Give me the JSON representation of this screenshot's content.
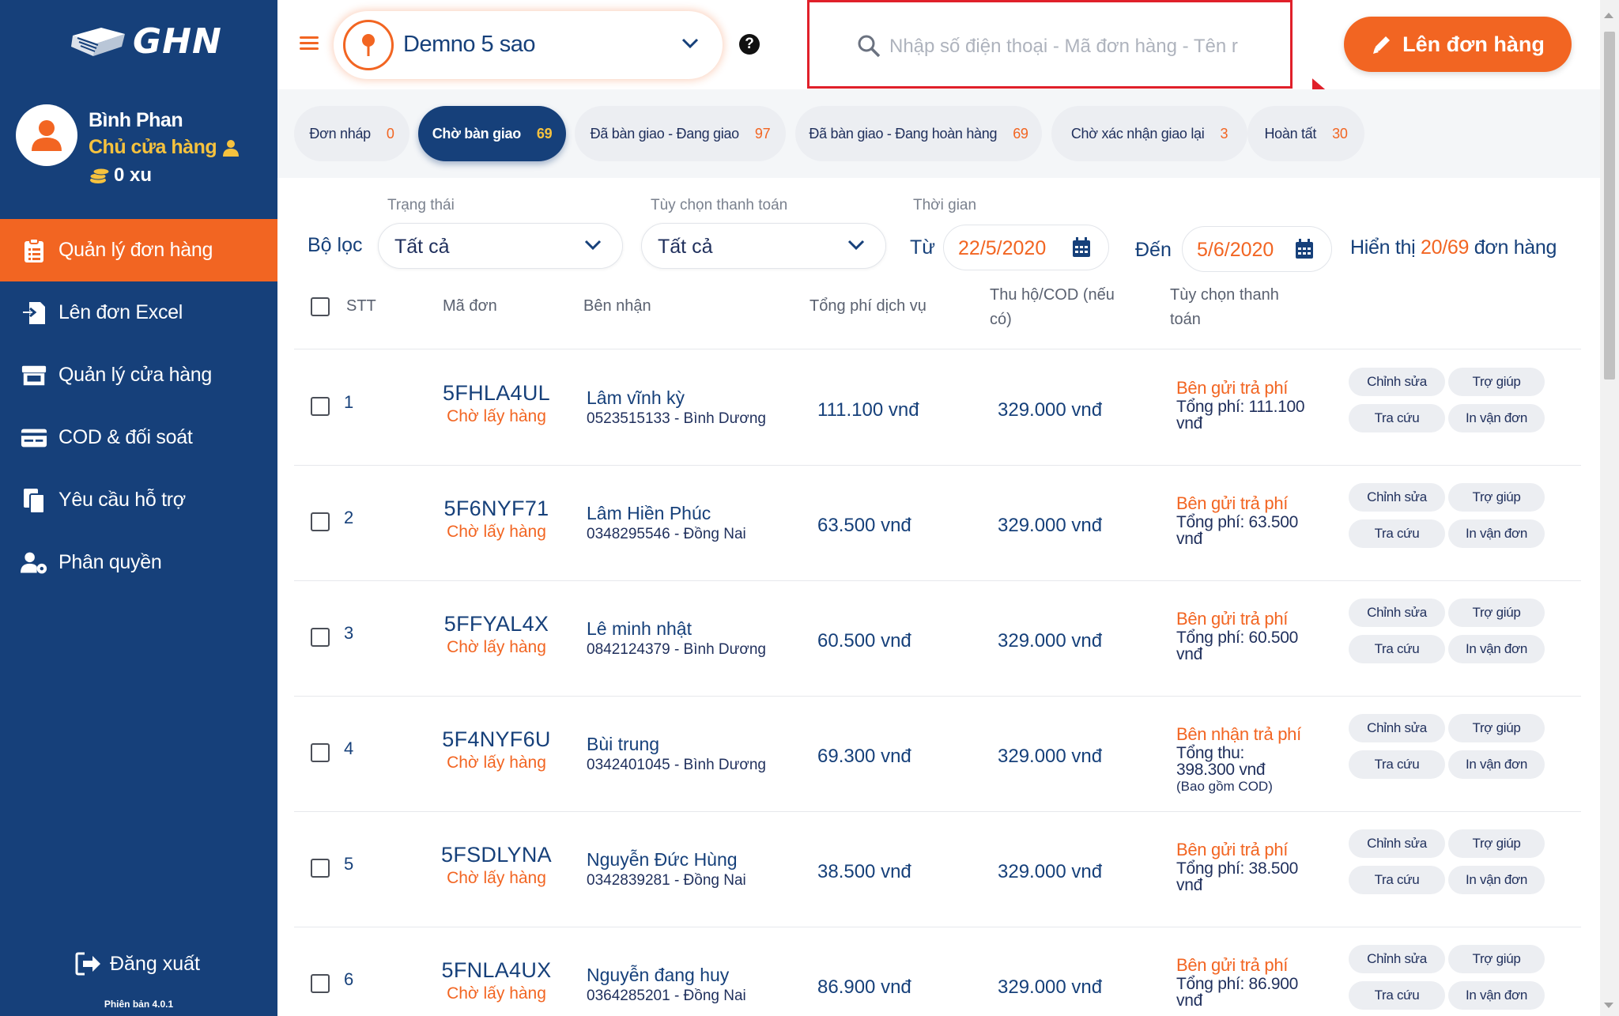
{
  "brand": {
    "logo_text": "GHN"
  },
  "user": {
    "name": "Bình Phan",
    "role": "Chủ cửa hàng",
    "coins": "0 xu"
  },
  "sidebar": {
    "items": [
      {
        "label": "Quản lý đơn hàng",
        "icon": "clipboard-icon",
        "active": true
      },
      {
        "label": "Lên đơn Excel",
        "icon": "file-import-icon",
        "active": false
      },
      {
        "label": "Quản lý cửa hàng",
        "icon": "store-icon",
        "active": false
      },
      {
        "label": "COD & đối soát",
        "icon": "card-icon",
        "active": false
      },
      {
        "label": "Yêu cầu hỗ trợ",
        "icon": "copy-icon",
        "active": false
      },
      {
        "label": "Phân quyền",
        "icon": "user-gear-icon",
        "active": false
      }
    ],
    "logout": "Đăng xuất",
    "version": "Phiên bản 4.0.1"
  },
  "header": {
    "store": "Demno 5 sao",
    "search_placeholder": "Nhập số điện thoại - Mã đơn hàng - Tên r",
    "create_button": "Lên đơn hàng"
  },
  "tabs": [
    {
      "label": "Đơn nháp",
      "count": "0"
    },
    {
      "label": "Chờ bàn giao",
      "count": "69"
    },
    {
      "label": "Đã bàn giao - Đang giao",
      "count": "97"
    },
    {
      "label": "Đã bàn giao - Đang hoàn hàng",
      "count": "69"
    },
    {
      "label": "Chờ xác nhận giao lại",
      "count": "3"
    },
    {
      "label": "Hoàn tất",
      "count": "30"
    }
  ],
  "filters": {
    "title": "Bộ lọc",
    "status_label": "Trạng thái",
    "status_value": "Tất cả",
    "payment_label": "Tùy chọn thanh toán",
    "payment_value": "Tất cả",
    "time_label": "Thời gian",
    "from_label": "Từ",
    "from_value": "22/5/2020",
    "to_label": "Đến",
    "to_value": "5/6/2020",
    "showing_prefix": "Hiển thị",
    "showing_count": "20/69",
    "showing_suffix": "đơn hàng"
  },
  "table": {
    "headers": {
      "stt": "STT",
      "code": "Mã đơn",
      "receiver": "Bên nhận",
      "fee": "Tổng phí dịch vụ",
      "cod_line1": "Thu hộ/COD (nếu",
      "cod_line2": "có)",
      "pay_line1": "Tùy chọn thanh",
      "pay_line2": "toán"
    },
    "actions": {
      "edit": "Chỉnh sửa",
      "help": "Trợ giúp",
      "lookup": "Tra cứu",
      "print": "In vận đơn"
    },
    "rows": [
      {
        "stt": "1",
        "code": "5FHLA4UL",
        "status": "Chờ lấy hàng",
        "name": "Lâm vĩnh kỳ",
        "contact": "0523515133 - Bình Dương",
        "fee": "111.100 vnđ",
        "cod": "329.000 vnđ",
        "pay_title": "Bên gửi trả phí",
        "pay_line1": "Tổng phí: 111.100",
        "pay_line2": "vnđ",
        "pay_note": ""
      },
      {
        "stt": "2",
        "code": "5F6NYF71",
        "status": "Chờ lấy hàng",
        "name": "Lâm Hiền Phúc",
        "contact": "0348295546 - Đồng Nai",
        "fee": "63.500 vnđ",
        "cod": "329.000 vnđ",
        "pay_title": "Bên gửi trả phí",
        "pay_line1": "Tổng phí: 63.500",
        "pay_line2": "vnđ",
        "pay_note": ""
      },
      {
        "stt": "3",
        "code": "5FFYAL4X",
        "status": "Chờ lấy hàng",
        "name": "Lê minh nhật",
        "contact": "0842124379 - Bình Dương",
        "fee": "60.500 vnđ",
        "cod": "329.000 vnđ",
        "pay_title": "Bên gửi trả phí",
        "pay_line1": "Tổng phí: 60.500",
        "pay_line2": "vnđ",
        "pay_note": ""
      },
      {
        "stt": "4",
        "code": "5F4NYF6U",
        "status": "Chờ lấy hàng",
        "name": "Bùi trung",
        "contact": "0342401045 - Bình Dương",
        "fee": "69.300 vnđ",
        "cod": "329.000 vnđ",
        "pay_title": "Bên nhận trả phí",
        "pay_line1": "Tổng thu:",
        "pay_line2": "398.300 vnđ",
        "pay_note": "(Bao gồm COD)"
      },
      {
        "stt": "5",
        "code": "5FSDLYNA",
        "status": "Chờ lấy hàng",
        "name": "Nguyễn Đức Hùng",
        "contact": "0342839281 - Đồng Nai",
        "fee": "38.500 vnđ",
        "cod": "329.000 vnđ",
        "pay_title": "Bên gửi trả phí",
        "pay_line1": "Tổng phí: 38.500",
        "pay_line2": "vnđ",
        "pay_note": ""
      },
      {
        "stt": "6",
        "code": "5FNLA4UX",
        "status": "Chờ lấy hàng",
        "name": "Nguyễn đang huy",
        "contact": "0364285201 - Đồng Nai",
        "fee": "86.900 vnđ",
        "cod": "329.000 vnđ",
        "pay_title": "Bên gửi trả phí",
        "pay_line1": "Tổng phí: 86.900",
        "pay_line2": "vnđ",
        "pay_note": ""
      }
    ]
  },
  "colors": {
    "primary": "#16407a",
    "accent": "#f26522",
    "gold": "#f6c23e",
    "highlight": "#e0202a"
  }
}
